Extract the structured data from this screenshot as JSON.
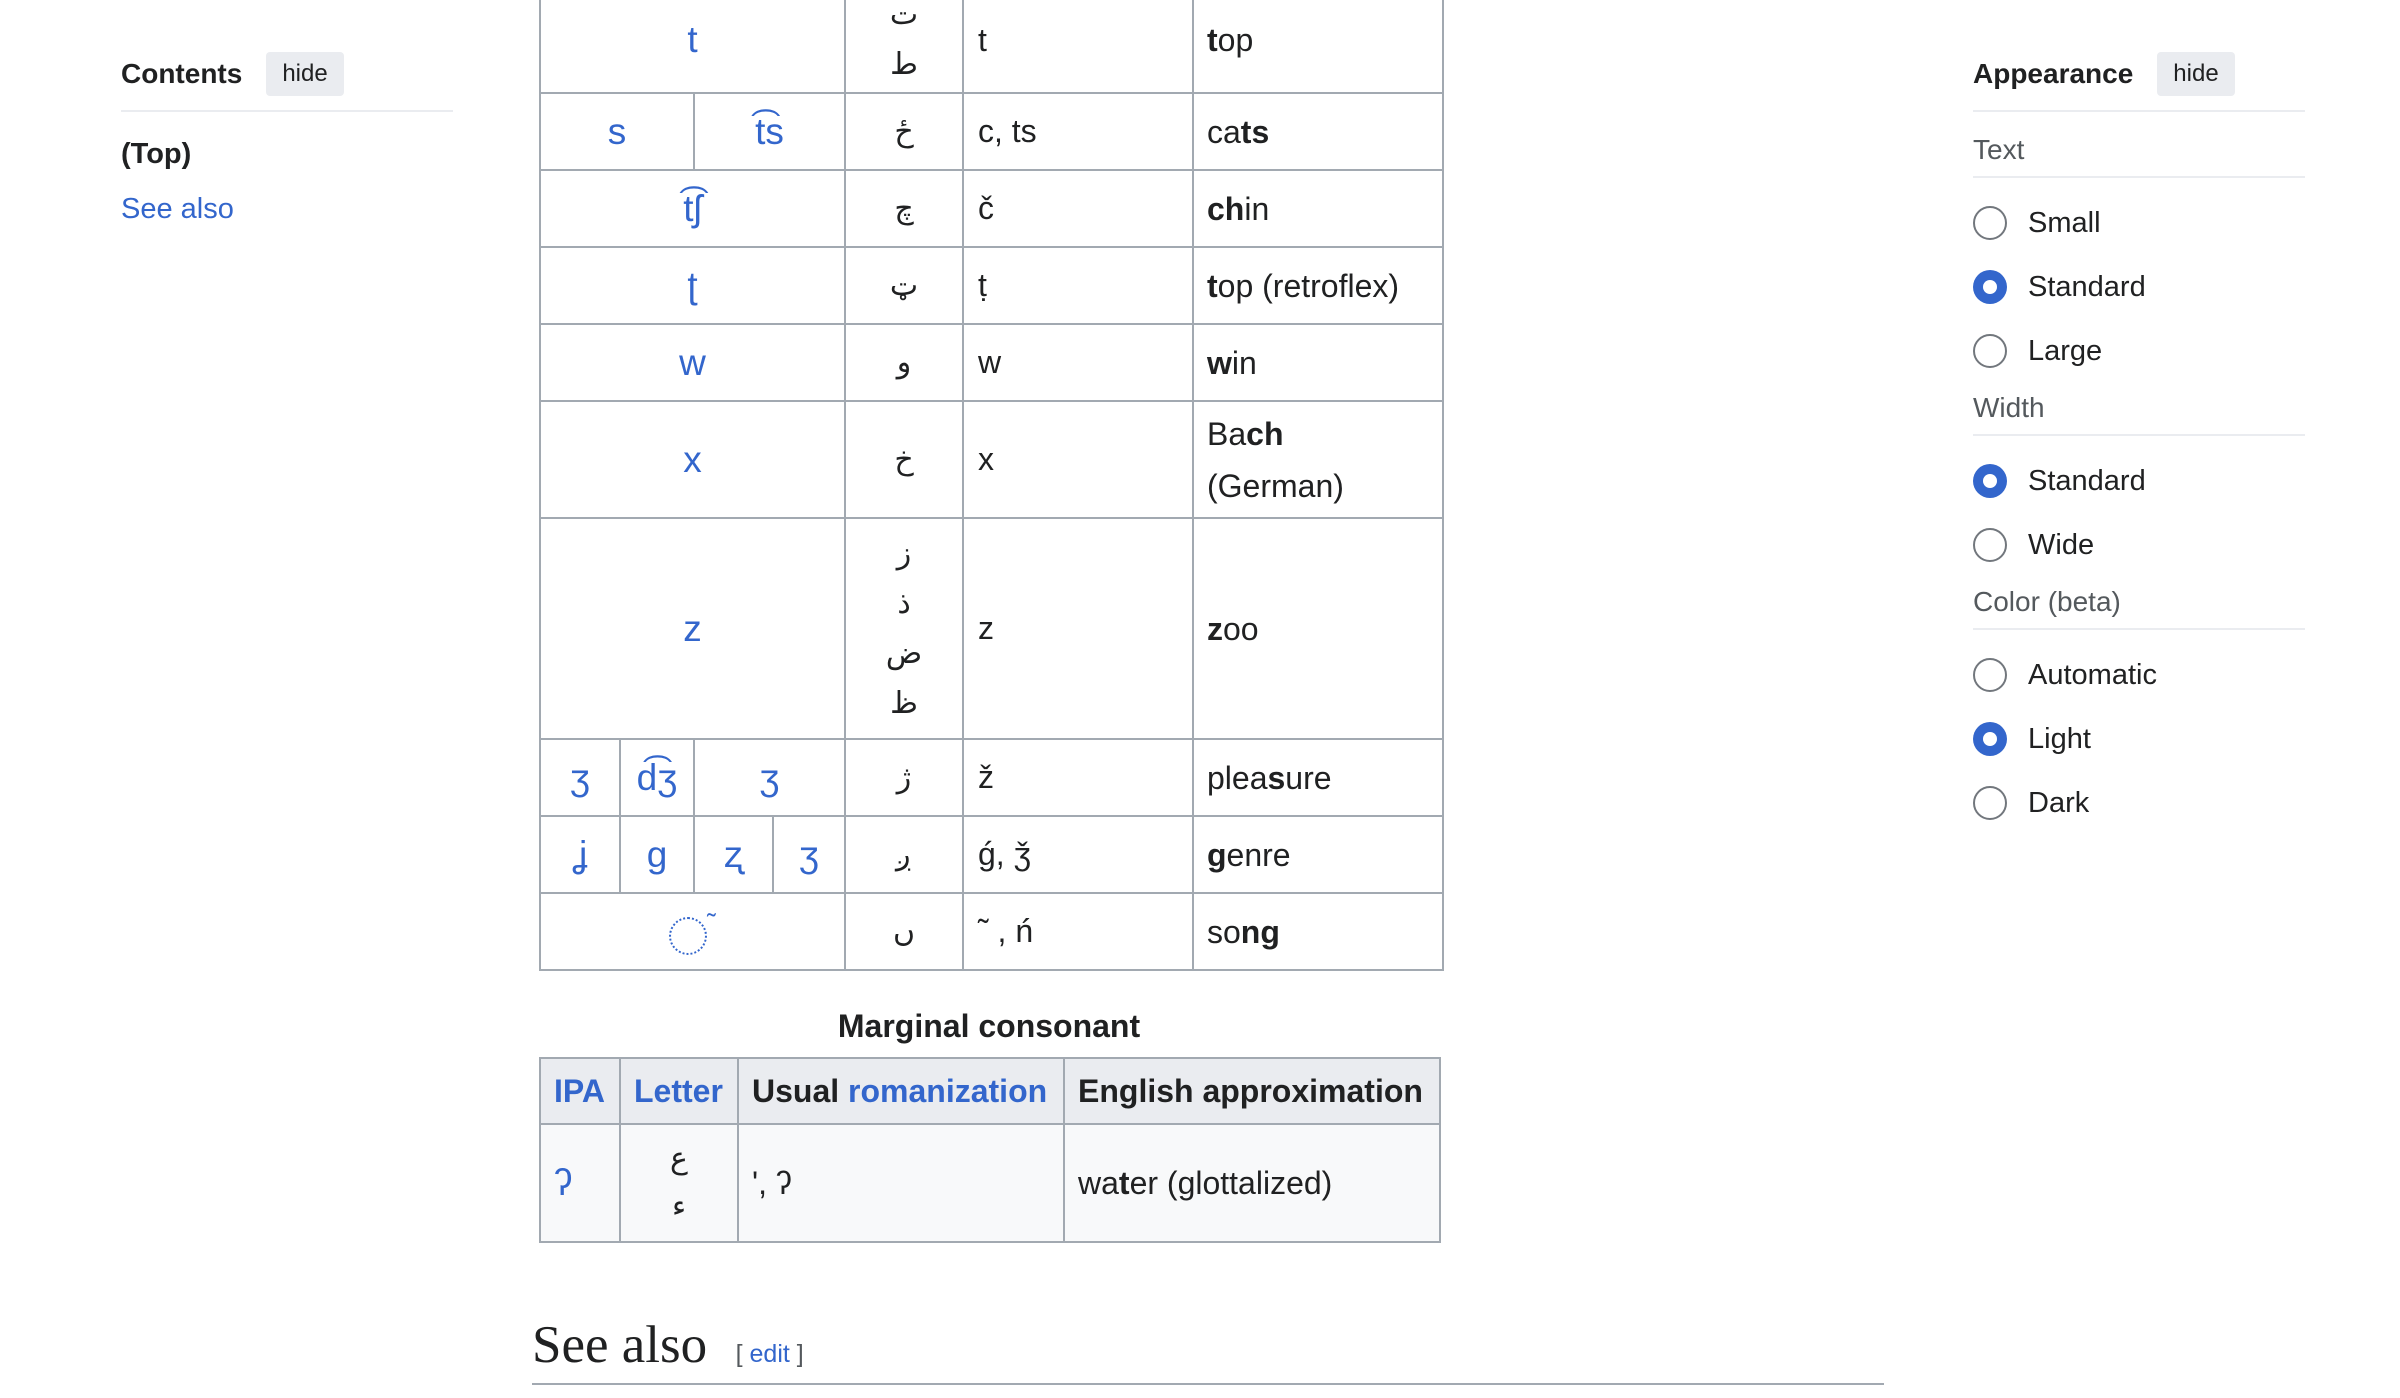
{
  "toc": {
    "title": "Contents",
    "hide_label": "hide",
    "top_label": "(Top)",
    "items": [
      "See also"
    ]
  },
  "appearance": {
    "title": "Appearance",
    "hide_label": "hide",
    "groups": [
      {
        "label": "Text",
        "options": [
          {
            "label": "Small",
            "checked": false
          },
          {
            "label": "Standard",
            "checked": true
          },
          {
            "label": "Large",
            "checked": false
          }
        ]
      },
      {
        "label": "Width",
        "options": [
          {
            "label": "Standard",
            "checked": true
          },
          {
            "label": "Wide",
            "checked": false
          }
        ]
      },
      {
        "label": "Color (beta)",
        "options": [
          {
            "label": "Automatic",
            "checked": false
          },
          {
            "label": "Light",
            "checked": true
          },
          {
            "label": "Dark",
            "checked": false
          }
        ]
      }
    ]
  },
  "main_table": {
    "rows": [
      {
        "ipa": [
          "t"
        ],
        "letters": [
          "ت",
          "ط"
        ],
        "romanization": "t",
        "english": [
          [
            "t",
            true
          ],
          [
            "op",
            false
          ]
        ]
      },
      {
        "ipa": [
          "s",
          "t͡s"
        ],
        "letters": [
          "ځ"
        ],
        "romanization": "c, ts",
        "english": [
          [
            "ca",
            false
          ],
          [
            "ts",
            true
          ]
        ]
      },
      {
        "ipa": [
          "t͡ʃ"
        ],
        "letters": [
          "چ"
        ],
        "romanization": "č",
        "english": [
          [
            "ch",
            true
          ],
          [
            "in",
            false
          ]
        ]
      },
      {
        "ipa": [
          "ʈ"
        ],
        "letters": [
          "ټ"
        ],
        "romanization": "ṭ",
        "english": [
          [
            "t",
            true
          ],
          [
            "op (retroflex)",
            false
          ]
        ]
      },
      {
        "ipa": [
          "w"
        ],
        "letters": [
          "و"
        ],
        "romanization": "w",
        "english": [
          [
            "w",
            true
          ],
          [
            "in",
            false
          ]
        ]
      },
      {
        "ipa": [
          "x"
        ],
        "letters": [
          "خ"
        ],
        "romanization": "x",
        "english": [
          [
            "Ba",
            false
          ],
          [
            "ch",
            true
          ],
          [
            " (German)",
            false
          ]
        ]
      },
      {
        "ipa": [
          "z"
        ],
        "letters": [
          "ز",
          "ذ",
          "ض",
          "ظ"
        ],
        "romanization": "z",
        "english": [
          [
            "z",
            true
          ],
          [
            "oo",
            false
          ]
        ]
      },
      {
        "ipa": [
          "ʒ",
          "d͡ʒ",
          "ʒ"
        ],
        "letters": [
          "ژ"
        ],
        "romanization": "ž",
        "english": [
          [
            "plea",
            false
          ],
          [
            "s",
            true
          ],
          [
            "ure",
            false
          ]
        ]
      },
      {
        "ipa": [
          "ʝ",
          "ɡ",
          "ʐ",
          "ʒ"
        ],
        "letters": [
          "ږ"
        ],
        "romanization": "ǵ, ǯ",
        "english": [
          [
            "g",
            true
          ],
          [
            "enre",
            false
          ]
        ]
      },
      {
        "ipa": [
          "◌̃"
        ],
        "letters": [
          "ں"
        ],
        "romanization": "˜ , ń",
        "english": [
          [
            "so",
            false
          ],
          [
            "ng",
            true
          ]
        ]
      }
    ]
  },
  "marginal": {
    "caption": "Marginal consonant",
    "headers": {
      "ipa": "IPA",
      "letter": "Letter",
      "usual": "Usual ",
      "romanization_link": "romanization",
      "english": "English approximation"
    },
    "row": {
      "ipa": "ʔ",
      "letters": [
        "ع",
        "ء"
      ],
      "romanization": "', ʔ",
      "english_pre": "wa",
      "english_bold": "t",
      "english_post": "er (glottalized)"
    }
  },
  "see_also": {
    "heading": "See also",
    "edit_open": "[",
    "edit_label": "edit",
    "edit_close": "]"
  }
}
